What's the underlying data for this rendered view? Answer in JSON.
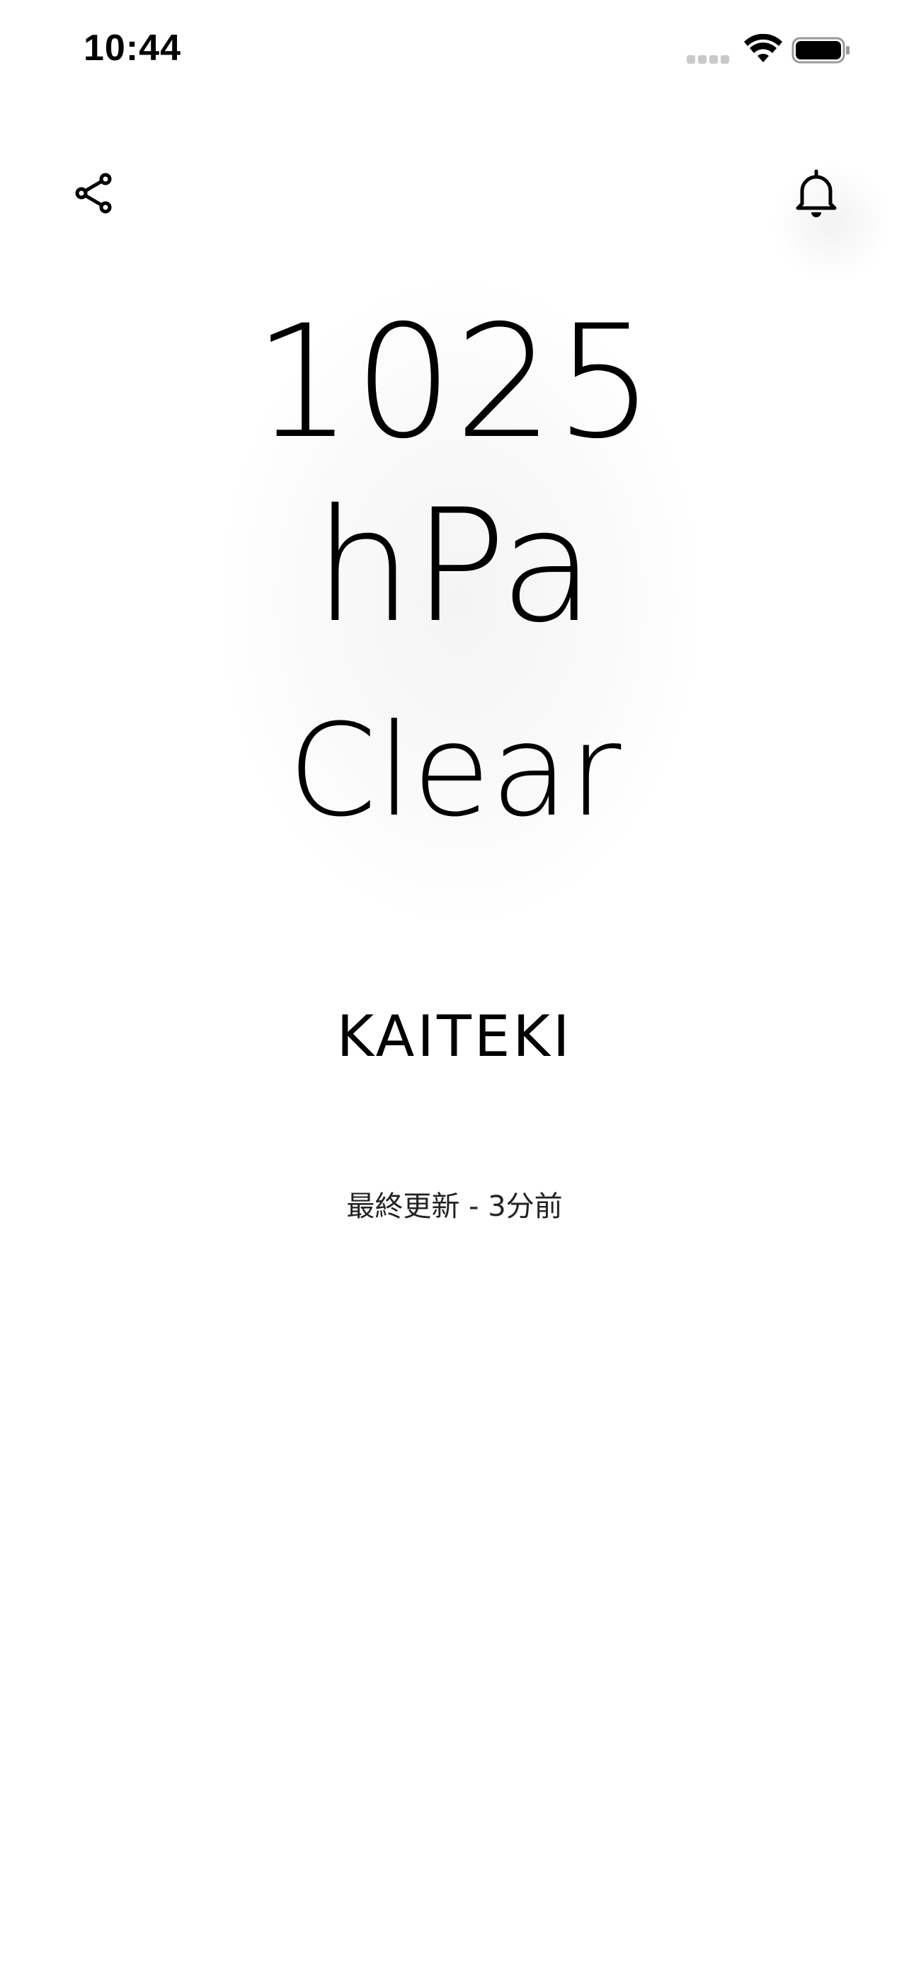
{
  "status_bar": {
    "time": "10:44",
    "icons": [
      "cellular-signal-icon",
      "wifi-icon",
      "battery-icon"
    ]
  },
  "toolbar": {
    "left_icon": "share-icon",
    "right_icon": "bell-icon"
  },
  "reading": {
    "pressure_value": "1025",
    "pressure_unit": "hPa",
    "condition": "Clear"
  },
  "comfort": {
    "label": "KAITEKI"
  },
  "last_update": {
    "text": "最終更新 - 3分前"
  },
  "colors": {
    "background": "#ffffff",
    "text": "#000000"
  }
}
